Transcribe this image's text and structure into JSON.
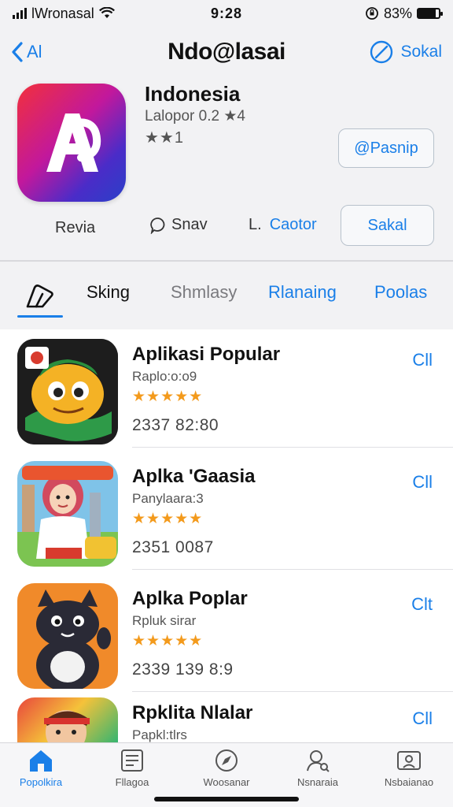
{
  "status_bar": {
    "carrier": "lWronasal",
    "time": "9:28",
    "battery": "83%",
    "battery_level": 0.83
  },
  "nav": {
    "back_label": "Al",
    "title": "Ndo@lasai",
    "action_label": "Sokal"
  },
  "app": {
    "name": "Indonesia",
    "subtitle": "Lalopor 0.2 ★4",
    "stars": "★★1",
    "open_label": "@Pasnip",
    "actions": {
      "review_label": "Revia",
      "share_label": "Snav",
      "creator_prefix": "L.",
      "creator_label": "Caotor",
      "button_label": "Sakal"
    }
  },
  "tabs": [
    {
      "label": "Sking",
      "color": "#111111"
    },
    {
      "label": "Shmlasy",
      "color": "#7a7a7e"
    },
    {
      "label": "Rlanaing",
      "color": "#1a7fe8"
    },
    {
      "label": "Poolas",
      "color": "#1a7fe8"
    }
  ],
  "list": [
    {
      "title": "Aplikasi Popular",
      "subtitle": "Raplo:o:o9",
      "stars": "★★★★★",
      "stats": "2337  82:80",
      "get_label": "Cll"
    },
    {
      "title": "Aplka 'Gaasia",
      "subtitle": "Panylaara:3",
      "stars": "★★★★★",
      "stats": "2351  0087",
      "get_label": "Cll"
    },
    {
      "title": "Aplka Poplar",
      "subtitle": "Rpluk sirar",
      "stars": "★★★★★",
      "stats": "2339  139  8:9",
      "get_label": "Clt"
    },
    {
      "title": "Rpklita Nlalar",
      "subtitle": "Papkl:tlrs",
      "stars": "",
      "stats": "",
      "get_label": "Cll"
    }
  ],
  "tab_bar": [
    {
      "label": "Popolkira",
      "icon": "home-icon",
      "active": true
    },
    {
      "label": "Fllagoa",
      "icon": "news-icon",
      "active": false
    },
    {
      "label": "Woosanar",
      "icon": "compass-icon",
      "active": false
    },
    {
      "label": "Nsnaraia",
      "icon": "search-person-icon",
      "active": false
    },
    {
      "label": "Nsbaianao",
      "icon": "account-icon",
      "active": false
    }
  ],
  "colors": {
    "accent": "#1a7fe8",
    "star": "#f39a1c"
  }
}
